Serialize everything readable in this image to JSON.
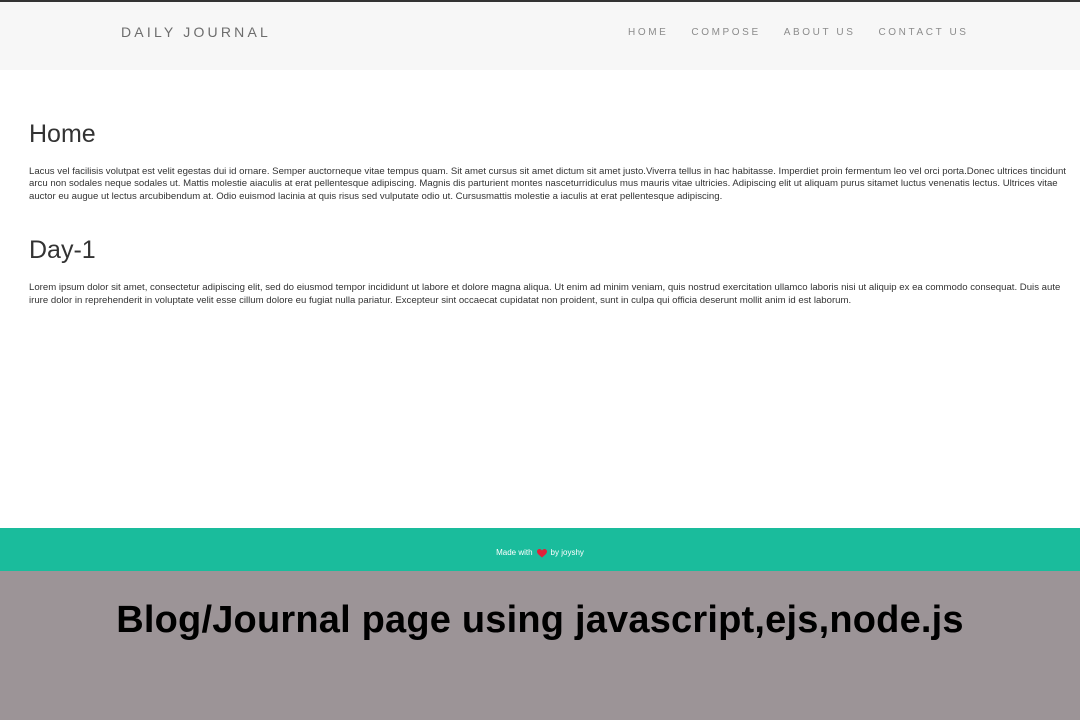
{
  "navbar": {
    "brand": "DAILY JOURNAL",
    "links": [
      "HOME",
      "COMPOSE",
      "ABOUT US",
      "CONTACT US"
    ]
  },
  "home": {
    "title": "Home",
    "body": "Lacus vel facilisis volutpat est velit egestas dui id ornare. Semper auctorneque vitae tempus quam. Sit amet cursus sit amet dictum sit amet justo.Viverra tellus in hac habitasse. Imperdiet proin fermentum leo vel orci porta.Donec ultrices tincidunt arcu non sodales neque sodales ut. Mattis molestie aiaculis at erat pellentesque adipiscing. Magnis dis parturient montes nasceturridiculus mus mauris vitae ultricies. Adipiscing elit ut aliquam purus sitamet luctus venenatis lectus. Ultrices vitae auctor eu augue ut lectus arcubibendum at. Odio euismod lacinia at quis risus sed vulputate odio ut. Cursusmattis molestie a iaculis at erat pellentesque adipiscing."
  },
  "posts": [
    {
      "title": "Day-1",
      "body": "Lorem ipsum dolor sit amet, consectetur adipiscing elit, sed do eiusmod tempor incididunt ut labore et dolore magna aliqua. Ut enim ad minim veniam, quis nostrud exercitation ullamco laboris nisi ut aliquip ex ea commodo consequat. Duis aute irure dolor in reprehenderit in voluptate velit esse cillum dolore eu fugiat nulla pariatur. Excepteur sint occaecat cupidatat non proident, sunt in culpa qui officia deserunt mollit anim id est laborum."
    }
  ],
  "footer": {
    "made_with": "Made with",
    "by": "by joyshy",
    "icon": "heart-icon"
  },
  "caption": "Blog/Journal page using javascript,ejs,node.js",
  "colors": {
    "footer_bg": "#1abc9c",
    "navbar_bg": "#f7f7f7",
    "caption_bg": "#9c9497",
    "heart": "#e0223a"
  }
}
